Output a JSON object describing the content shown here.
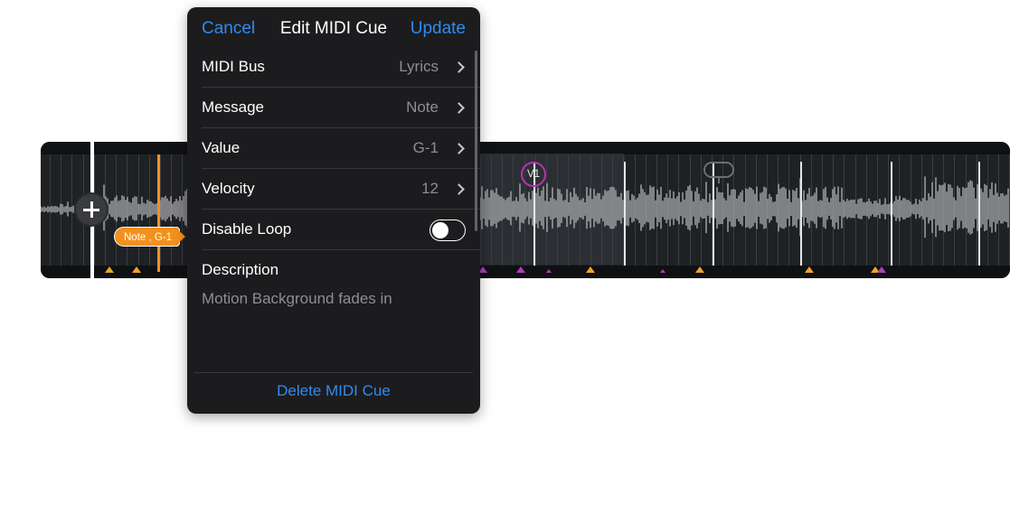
{
  "popover": {
    "cancel": "Cancel",
    "title": "Edit MIDI Cue",
    "update": "Update",
    "rows": [
      {
        "label": "MIDI Bus",
        "value": "Lyrics"
      },
      {
        "label": "Message",
        "value": "Note"
      },
      {
        "label": "Value",
        "value": "G-1"
      },
      {
        "label": "Velocity",
        "value": "12"
      }
    ],
    "disable_loop": {
      "label": "Disable Loop",
      "enabled": false
    },
    "description": {
      "label": "Description",
      "text": "Motion Background fades in"
    },
    "delete": "Delete MIDI Cue"
  },
  "timeline": {
    "cue_tag": "Note , G-1",
    "section_marker": "V1"
  },
  "colors": {
    "accent_blue": "#2f8cf0",
    "cue_orange": "#f2911d",
    "marker_purple": "#b533b0",
    "panel_bg": "#1c1c1e",
    "timeline_bg": "#17181b"
  },
  "icons": [
    "plus-icon",
    "chevron-right-icon",
    "loop-icon",
    "cue-marker-icon"
  ]
}
